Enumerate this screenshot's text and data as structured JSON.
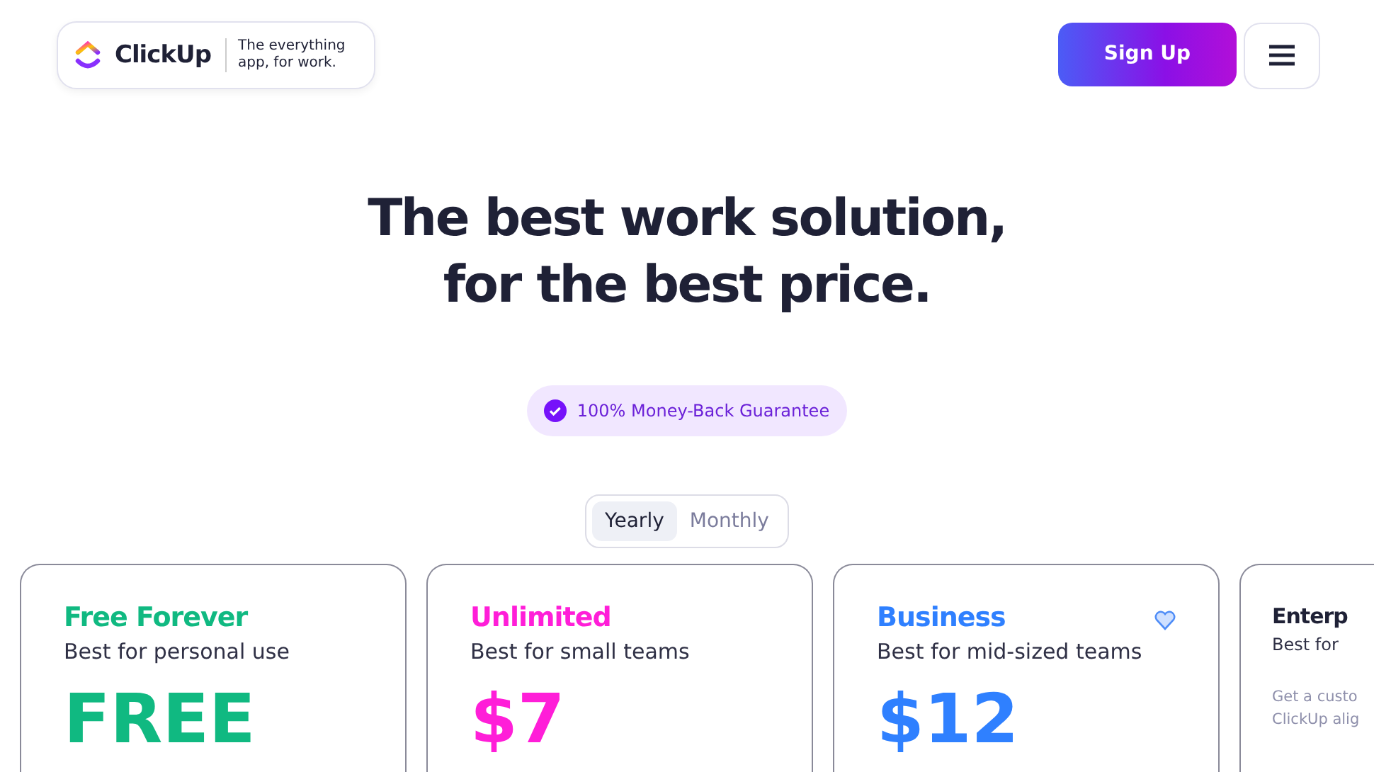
{
  "header": {
    "brand": "ClickUp",
    "tagline": "The everything app, for work.",
    "signup": "Sign Up"
  },
  "hero": {
    "title_lines": [
      "The best work solution,",
      "for the best price."
    ],
    "guarantee": "100% Money-Back Guarantee"
  },
  "billing_tabs": [
    {
      "label": "Yearly",
      "selected": true
    },
    {
      "label": "Monthly",
      "selected": false
    }
  ],
  "plans": [
    {
      "name": "Free Forever",
      "subtitle": "Best for personal use",
      "price": "FREE",
      "color": "#10b981",
      "heart": false
    },
    {
      "name": "Unlimited",
      "subtitle": "Best for small teams",
      "price": "$7",
      "color": "#ff1ed8",
      "heart": false
    },
    {
      "name": "Business",
      "subtitle": "Best for mid-sized teams",
      "price": "$12",
      "color": "#2f80ff",
      "heart": true
    },
    {
      "name": "Enterp",
      "subtitle": "Best for",
      "color": "#1f2136",
      "heart": false,
      "note_lines": [
        "Get a custo",
        "ClickUp alig"
      ]
    }
  ]
}
